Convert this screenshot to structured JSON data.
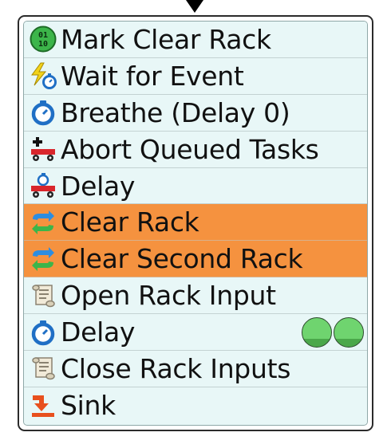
{
  "block": {
    "rows": [
      {
        "label": "Mark Clear Rack",
        "icon": "binary-counter-icon",
        "selected": false
      },
      {
        "label": "Wait for Event",
        "icon": "lightning-timer-icon",
        "selected": false
      },
      {
        "label": "Breathe (Delay 0)",
        "icon": "stopwatch-icon",
        "selected": false
      },
      {
        "label": "Abort Queued Tasks",
        "icon": "cart-plus-icon",
        "selected": false
      },
      {
        "label": "Delay",
        "icon": "cart-timer-icon",
        "selected": false
      },
      {
        "label": "Clear Rack",
        "icon": "exchange-arrows-icon",
        "selected": true
      },
      {
        "label": "Clear Second Rack",
        "icon": "exchange-arrows-icon",
        "selected": true
      },
      {
        "label": "Open Rack Input",
        "icon": "scroll-icon",
        "selected": false
      },
      {
        "label": "Delay",
        "icon": "stopwatch-icon",
        "selected": false,
        "indicators": 2
      },
      {
        "label": "Close Rack Inputs",
        "icon": "scroll-icon",
        "selected": false
      },
      {
        "label": "Sink",
        "icon": "sink-arrow-icon",
        "selected": false
      }
    ]
  },
  "colors": {
    "row_bg": "#e8f7f7",
    "selected_bg": "#f5923f",
    "indicator_green": "#6fd46f"
  }
}
